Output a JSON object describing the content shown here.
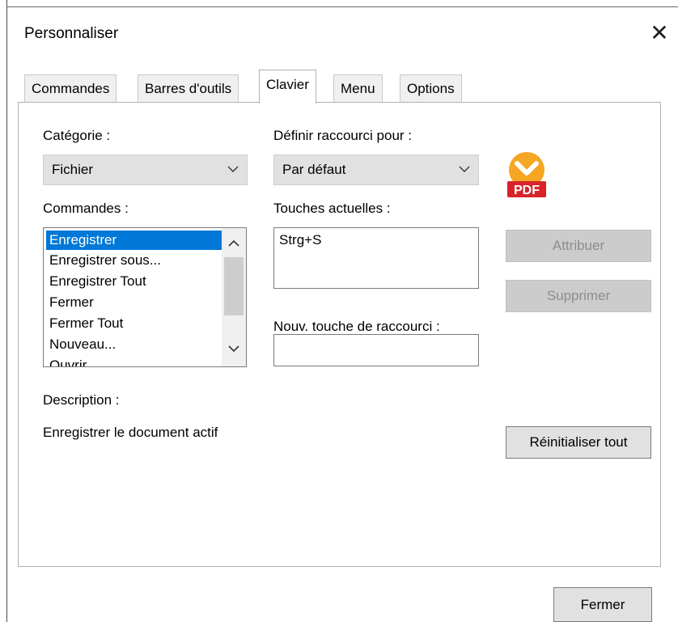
{
  "window": {
    "title": "Personnaliser",
    "close_glyph": "✕"
  },
  "tabs": [
    {
      "label": "Commandes",
      "active": false
    },
    {
      "label": "Barres d'outils",
      "active": false
    },
    {
      "label": "Clavier",
      "active": true
    },
    {
      "label": "Menu",
      "active": false
    },
    {
      "label": "Options",
      "active": false
    }
  ],
  "category": {
    "label": "Catégorie :",
    "value": "Fichier"
  },
  "shortcut_for": {
    "label": "Définir raccourci pour :",
    "value": "Par défaut"
  },
  "commands": {
    "label": "Commandes :",
    "items": [
      "Enregistrer",
      "Enregistrer sous...",
      "Enregistrer Tout",
      "Fermer",
      "Fermer Tout",
      "Nouveau...",
      "Ouvrir..."
    ],
    "selected": "Enregistrer"
  },
  "current_keys": {
    "label": "Touches actuelles :",
    "items": [
      "Strg+S"
    ]
  },
  "new_shortcut": {
    "label": "Nouv. touche de raccourci :",
    "value": ""
  },
  "buttons": {
    "assign": "Attribuer",
    "remove": "Supprimer",
    "reset_all": "Réinitialiser tout",
    "close": "Fermer"
  },
  "description": {
    "label": "Description :",
    "text": "Enregistrer le document actif"
  },
  "icons": {
    "app_logo": "pdf-app-icon",
    "logo_text": "PDF"
  },
  "colors": {
    "selection": "#0078d7",
    "logo_orange": "#f5a623",
    "logo_red": "#d8232a"
  }
}
